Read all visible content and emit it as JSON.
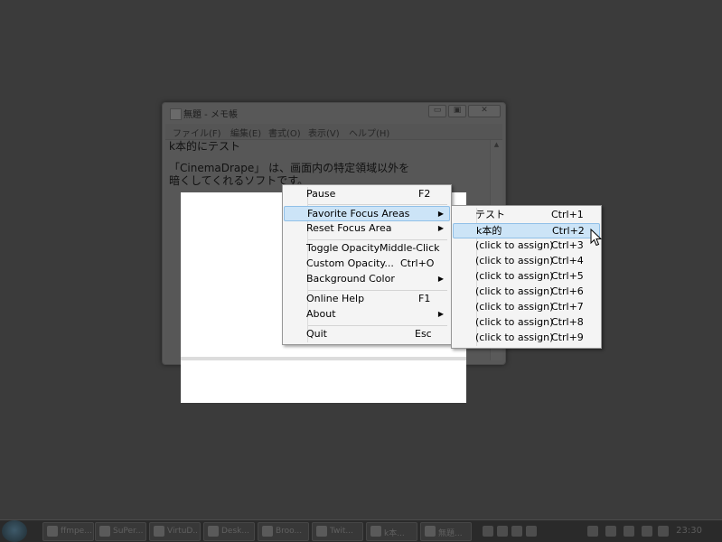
{
  "notepad": {
    "title": "無題 - メモ帳",
    "controls": [
      "▭",
      "▣",
      "✕"
    ],
    "menubar": [
      "ファイル(F)",
      "編集(E)",
      "書式(O)",
      "表示(V)",
      "ヘルプ(H)"
    ],
    "lines": [
      "k本的にテスト",
      "",
      "「CinemaDrape」 は、画面内の特定領域以外を",
      "暗くしてくれるソフトです。"
    ]
  },
  "context_menu": {
    "items": [
      {
        "label": "Pause",
        "shortcut": "F2"
      },
      {
        "label": "Favorite Focus Areas",
        "submenu": true,
        "highlighted": true
      },
      {
        "label": "Reset Focus Area",
        "submenu": true
      },
      {
        "label": "Toggle Opacity",
        "shortcut": "Middle-Click"
      },
      {
        "label": "Custom Opacity...",
        "shortcut": "Ctrl+O"
      },
      {
        "label": "Background Color",
        "submenu": true
      },
      {
        "label": "Online Help",
        "shortcut": "F1"
      },
      {
        "label": "About",
        "submenu": true
      },
      {
        "label": "Quit",
        "shortcut": "Esc"
      }
    ]
  },
  "submenu": {
    "items": [
      {
        "label": "テスト",
        "shortcut": "Ctrl+1"
      },
      {
        "label": "k本的",
        "shortcut": "Ctrl+2",
        "highlighted": true
      },
      {
        "label": "(click to assign)",
        "shortcut": "Ctrl+3"
      },
      {
        "label": "(click to assign)",
        "shortcut": "Ctrl+4"
      },
      {
        "label": "(click to assign)",
        "shortcut": "Ctrl+5"
      },
      {
        "label": "(click to assign)",
        "shortcut": "Ctrl+6"
      },
      {
        "label": "(click to assign)",
        "shortcut": "Ctrl+7"
      },
      {
        "label": "(click to assign)",
        "shortcut": "Ctrl+8"
      },
      {
        "label": "(click to assign)",
        "shortcut": "Ctrl+9"
      }
    ]
  },
  "taskbar": {
    "buttons": [
      "ffmpe...",
      "SuPer...",
      "VirtuD...",
      "Desk...",
      "Broo...",
      "Twit...",
      "k本...",
      "無題..."
    ],
    "clock": "23:30"
  },
  "colors": {
    "dim_background": "#3b3b3b",
    "menu_background": "#f4f4f4",
    "highlight": "#cce4f7"
  }
}
